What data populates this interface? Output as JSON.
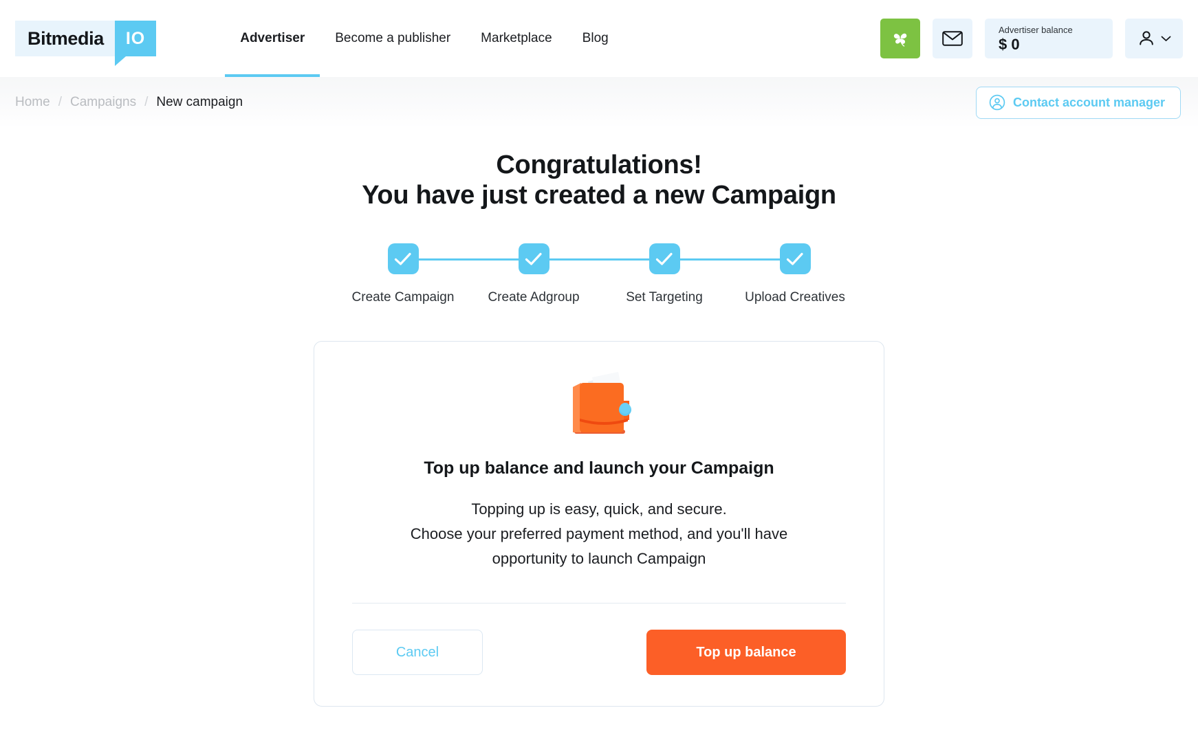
{
  "header": {
    "logo": {
      "word": "Bitmedia",
      "tag": "IO"
    },
    "nav": [
      {
        "label": "Advertiser",
        "active": true
      },
      {
        "label": "Become a publisher",
        "active": false
      },
      {
        "label": "Marketplace",
        "active": false
      },
      {
        "label": "Blog",
        "active": false
      }
    ],
    "clover_icon": "clover-icon",
    "mail_icon": "envelope-icon",
    "balance": {
      "label": "Advertiser balance",
      "value": "$ 0"
    },
    "account": {
      "user_icon": "user-icon",
      "chevron_icon": "chevron-down-icon"
    }
  },
  "breadcrumb": {
    "items": [
      "Home",
      "Campaigns",
      "New campaign"
    ],
    "separator": "/"
  },
  "contact": {
    "label": "Contact account manager",
    "icon": "user-circle-icon"
  },
  "main": {
    "title_line1": "Congratulations!",
    "title_line2": "You have just created a new Campaign",
    "steps": [
      {
        "label": "Create Campaign",
        "state": "complete"
      },
      {
        "label": "Create Adgroup",
        "state": "complete"
      },
      {
        "label": "Set Targeting",
        "state": "complete"
      },
      {
        "label": "Upload Creatives",
        "state": "complete"
      }
    ],
    "card": {
      "illustration": "wallet-icon",
      "title": "Top up balance and launch your Campaign",
      "body_line1": "Topping up is easy, quick, and secure.",
      "body_line2": "Choose your preferred payment method, and you'll have",
      "body_line3": "opportunity to launch Campaign",
      "cancel_label": "Cancel",
      "topup_label": "Top up balance"
    }
  },
  "colors": {
    "accent_cyan": "#5ccaf2",
    "accent_orange": "#fc5f27",
    "clover_green": "#7dc242",
    "light_blue_bg": "#eaf4fc"
  }
}
